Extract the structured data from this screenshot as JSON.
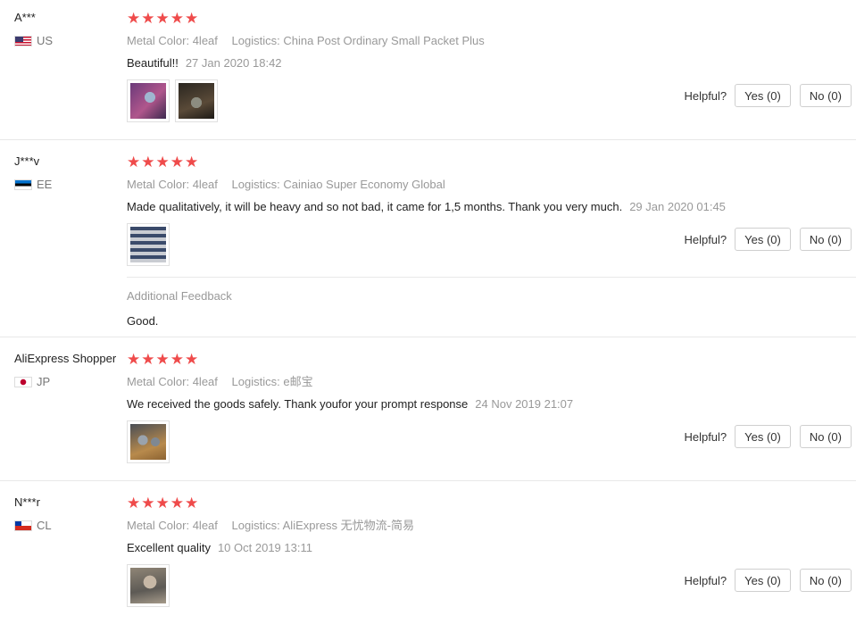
{
  "helpful_label": "Helpful?",
  "yes_label": "Yes (0)",
  "no_label": "No (0)",
  "metal_color_key": "Metal Color:",
  "logistics_key": "Logistics:",
  "additional_feedback_title": "Additional Feedback",
  "star_color": "#ef4b4b",
  "reviews": [
    {
      "user": "A***",
      "country": "US",
      "flag": "us-flag-icon",
      "rating": 5,
      "stars": "★★★★★",
      "metal_color": "4leaf",
      "logistics": "China Post Ordinary Small Packet Plus",
      "text": "Beautiful!!",
      "date": "27 Jan 2020 18:42",
      "photos": [
        "product-photo-necklace-purple",
        "product-photo-necklace-dark"
      ]
    },
    {
      "user": "J***v",
      "country": "EE",
      "flag": "ee-flag-icon",
      "rating": 5,
      "stars": "★★★★★",
      "metal_color": "4leaf",
      "logistics": "Cainiao Super Economy Global",
      "text": "Made qualitatively, it will be heavy and so not bad, it came for 1,5 months. Thank you very much.",
      "date": "29 Jan 2020 01:45",
      "photos": [
        "product-photo-striped"
      ],
      "additional_feedback": "Good."
    },
    {
      "user": "AliExpress Shopper",
      "country": "JP",
      "flag": "jp-flag-icon",
      "rating": 5,
      "stars": "★★★★★",
      "metal_color": "4leaf",
      "logistics": "e邮宝",
      "text": "We received the goods safely. Thank youfor your prompt response",
      "date": "24 Nov 2019 21:07",
      "photos": [
        "product-photo-pendants"
      ]
    },
    {
      "user": "N***r",
      "country": "CL",
      "flag": "cl-flag-icon",
      "rating": 5,
      "stars": "★★★★★",
      "metal_color": "4leaf",
      "logistics": "AliExpress 无忧物流-简易",
      "text": "Excellent quality",
      "date": "10 Oct 2019 13:11",
      "photos": [
        "product-photo-hand"
      ]
    }
  ]
}
